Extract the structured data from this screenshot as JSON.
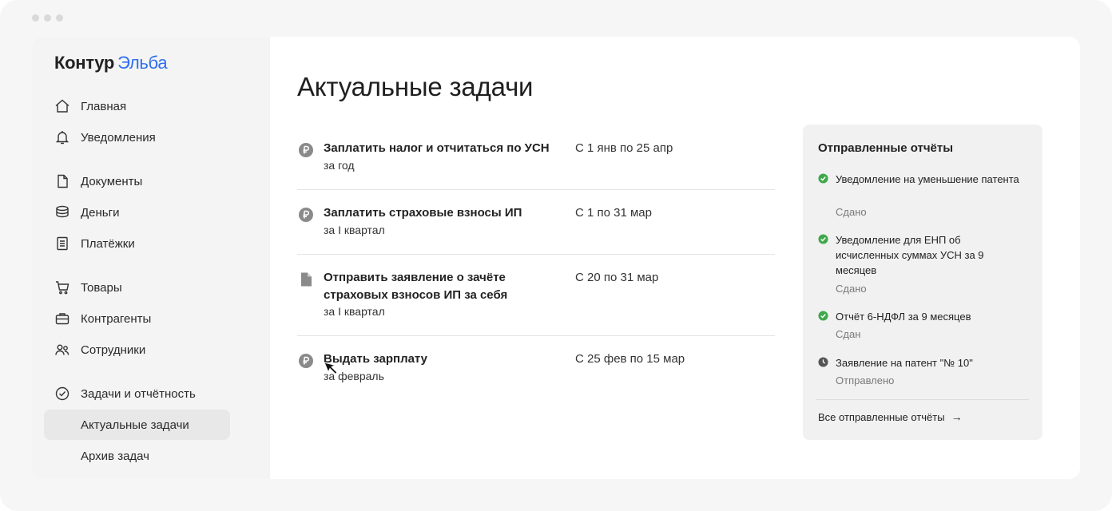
{
  "window": {
    "dots": [
      "close",
      "minimize",
      "maximize"
    ]
  },
  "logo": {
    "part1": "Контур",
    "part2": "Эльба"
  },
  "sidebar": {
    "items": [
      {
        "label": "Главная",
        "icon": "home-icon"
      },
      {
        "label": "Уведомления",
        "icon": "bell-icon"
      },
      {
        "label": "Документы",
        "icon": "document-icon"
      },
      {
        "label": "Деньги",
        "icon": "coins-icon"
      },
      {
        "label": "Платёжки",
        "icon": "receipt-icon"
      },
      {
        "label": "Товары",
        "icon": "cart-icon"
      },
      {
        "label": "Контрагенты",
        "icon": "briefcase-icon"
      },
      {
        "label": "Сотрудники",
        "icon": "people-icon"
      },
      {
        "label": "Задачи и отчётность",
        "icon": "check-circle-icon"
      },
      {
        "label": "Актуальные задачи",
        "active": true
      },
      {
        "label": "Архив задач"
      }
    ]
  },
  "main": {
    "title": "Актуальные задачи",
    "tasks": [
      {
        "name": "Заплатить налог и отчитаться по УСН",
        "period": "за год",
        "date": "С 1 янв по 25 апр",
        "icon": "ruble-icon"
      },
      {
        "name": "Заплатить страховые взносы ИП",
        "period": "за I квартал",
        "date": "С 1 по 31 мар",
        "icon": "ruble-icon"
      },
      {
        "name": "Отправить заявление о зачёте страховых взносов ИП за себя",
        "period": "за I квартал",
        "date": "С 20 по 31 мар",
        "icon": "document-icon"
      },
      {
        "name": "Выдать зарплату",
        "period": "за февраль",
        "date": "С 25 фев по 15 мар",
        "icon": "ruble-icon"
      }
    ]
  },
  "reports_panel": {
    "title": "Отправленные отчёты",
    "items": [
      {
        "name": "Уведомление на уменьшение патента",
        "status": "Сдано",
        "icon": "check-icon"
      },
      {
        "name": "Уведомление для ЕНП об исчисленных суммах УСН за 9 месяцев",
        "status": "Сдано",
        "icon": "check-icon"
      },
      {
        "name": "Отчёт 6-НДФЛ за 9 месяцев",
        "status": "Сдан",
        "icon": "check-icon"
      },
      {
        "name": "Заявление на патент \"№ 10\"",
        "status": "Отправлено",
        "icon": "clock-icon"
      }
    ],
    "link": "Все отправленные отчёты",
    "link_icon": "arrow-right-icon"
  },
  "colors": {
    "accent": "#2f6ff0",
    "success": "#3ea84a",
    "icon_gray": "#8a8a8a",
    "sidebar_bg": "#f4f4f4",
    "panel_bg": "#f1f1f1"
  }
}
